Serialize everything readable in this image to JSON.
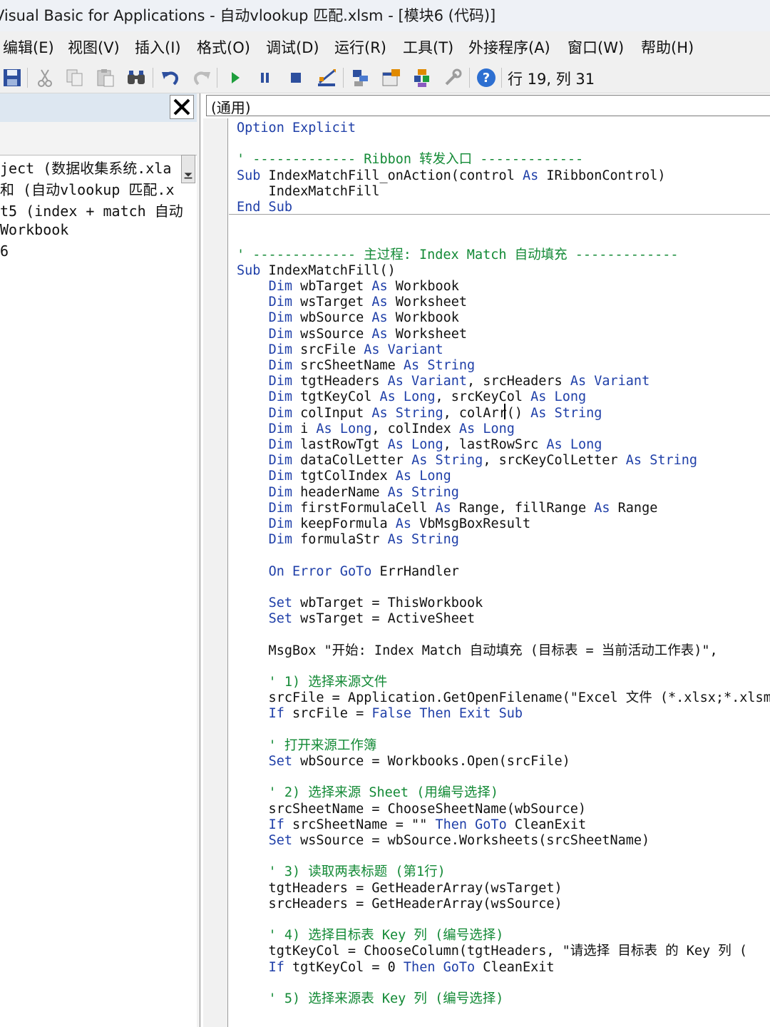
{
  "window": {
    "title": "Visual Basic for Applications - 自动vlookup 匹配.xlsm - [模块6 (代码)]"
  },
  "menu": [
    "编辑(E)",
    "视图(V)",
    "插入(I)",
    "格式(O)",
    "调试(D)",
    "运行(R)",
    "工具(T)",
    "外接程序(A)",
    "窗口(W)",
    "帮助(H)"
  ],
  "toolbar": {
    "icons": [
      "save-icon",
      "cut-icon",
      "copy-icon",
      "paste-icon",
      "find-icon",
      "undo-icon",
      "redo-icon",
      "run-icon",
      "break-icon",
      "reset-icon",
      "design-mode-icon",
      "project-explorer-icon",
      "properties-icon",
      "object-browser-icon",
      "toolbox-icon",
      "help-icon"
    ],
    "cursor_position": "行 19, 列 31"
  },
  "project_explorer": {
    "items": [
      "ject (数据收集系统.xla",
      "和 (自动vlookup 匹配.x",
      "t5 (index + match 自动",
      "Workbook",
      "6"
    ]
  },
  "code_window": {
    "object_combo": "(通用)",
    "lines": [
      [
        {
          "t": "Option Explicit",
          "c": "kw"
        }
      ],
      [],
      [
        {
          "t": "' ------------- Ribbon 转发入口 -------------",
          "c": "cm"
        }
      ],
      [
        {
          "t": "Sub",
          "c": "kw"
        },
        {
          "t": " IndexMatchFill_onAction(control "
        },
        {
          "t": "As",
          "c": "kw"
        },
        {
          "t": " IRibbonControl)"
        }
      ],
      [
        {
          "t": "    IndexMatchFill"
        }
      ],
      [
        {
          "t": "End Sub",
          "c": "kw"
        }
      ],
      [],
      [],
      [
        {
          "t": "' ------------- 主过程: Index Match 自动填充 -------------",
          "c": "cm"
        }
      ],
      [
        {
          "t": "Sub",
          "c": "kw"
        },
        {
          "t": " IndexMatchFill()"
        }
      ],
      [
        {
          "t": "    "
        },
        {
          "t": "Dim",
          "c": "kw"
        },
        {
          "t": " wbTarget "
        },
        {
          "t": "As",
          "c": "kw"
        },
        {
          "t": " Workbook"
        }
      ],
      [
        {
          "t": "    "
        },
        {
          "t": "Dim",
          "c": "kw"
        },
        {
          "t": " wsTarget "
        },
        {
          "t": "As",
          "c": "kw"
        },
        {
          "t": " Worksheet"
        }
      ],
      [
        {
          "t": "    "
        },
        {
          "t": "Dim",
          "c": "kw"
        },
        {
          "t": " wbSource "
        },
        {
          "t": "As",
          "c": "kw"
        },
        {
          "t": " Workbook"
        }
      ],
      [
        {
          "t": "    "
        },
        {
          "t": "Dim",
          "c": "kw"
        },
        {
          "t": " wsSource "
        },
        {
          "t": "As",
          "c": "kw"
        },
        {
          "t": " Worksheet"
        }
      ],
      [
        {
          "t": "    "
        },
        {
          "t": "Dim",
          "c": "kw"
        },
        {
          "t": " srcFile "
        },
        {
          "t": "As Variant",
          "c": "kw"
        }
      ],
      [
        {
          "t": "    "
        },
        {
          "t": "Dim",
          "c": "kw"
        },
        {
          "t": " srcSheetName "
        },
        {
          "t": "As String",
          "c": "kw"
        }
      ],
      [
        {
          "t": "    "
        },
        {
          "t": "Dim",
          "c": "kw"
        },
        {
          "t": " tgtHeaders "
        },
        {
          "t": "As Variant",
          "c": "kw"
        },
        {
          "t": ", srcHeaders "
        },
        {
          "t": "As Variant",
          "c": "kw"
        }
      ],
      [
        {
          "t": "    "
        },
        {
          "t": "Dim",
          "c": "kw"
        },
        {
          "t": " tgtKeyCol "
        },
        {
          "t": "As Long",
          "c": "kw"
        },
        {
          "t": ", srcKeyCol "
        },
        {
          "t": "As Long",
          "c": "kw"
        }
      ],
      [
        {
          "t": "    "
        },
        {
          "t": "Dim",
          "c": "kw"
        },
        {
          "t": " colInput "
        },
        {
          "t": "As String",
          "c": "kw"
        },
        {
          "t": ", colArr() "
        },
        {
          "t": "As String",
          "c": "kw"
        }
      ],
      [
        {
          "t": "    "
        },
        {
          "t": "Dim",
          "c": "kw"
        },
        {
          "t": " i "
        },
        {
          "t": "As Long",
          "c": "kw"
        },
        {
          "t": ", colIndex "
        },
        {
          "t": "As Long",
          "c": "kw"
        }
      ],
      [
        {
          "t": "    "
        },
        {
          "t": "Dim",
          "c": "kw"
        },
        {
          "t": " lastRowTgt "
        },
        {
          "t": "As Long",
          "c": "kw"
        },
        {
          "t": ", lastRowSrc "
        },
        {
          "t": "As Long",
          "c": "kw"
        }
      ],
      [
        {
          "t": "    "
        },
        {
          "t": "Dim",
          "c": "kw"
        },
        {
          "t": " dataColLetter "
        },
        {
          "t": "As String",
          "c": "kw"
        },
        {
          "t": ", srcKeyColLetter "
        },
        {
          "t": "As String",
          "c": "kw"
        }
      ],
      [
        {
          "t": "    "
        },
        {
          "t": "Dim",
          "c": "kw"
        },
        {
          "t": " tgtColIndex "
        },
        {
          "t": "As Long",
          "c": "kw"
        }
      ],
      [
        {
          "t": "    "
        },
        {
          "t": "Dim",
          "c": "kw"
        },
        {
          "t": " headerName "
        },
        {
          "t": "As String",
          "c": "kw"
        }
      ],
      [
        {
          "t": "    "
        },
        {
          "t": "Dim",
          "c": "kw"
        },
        {
          "t": " firstFormulaCell "
        },
        {
          "t": "As",
          "c": "kw"
        },
        {
          "t": " Range, fillRange "
        },
        {
          "t": "As",
          "c": "kw"
        },
        {
          "t": " Range"
        }
      ],
      [
        {
          "t": "    "
        },
        {
          "t": "Dim",
          "c": "kw"
        },
        {
          "t": " keepFormula "
        },
        {
          "t": "As",
          "c": "kw"
        },
        {
          "t": " VbMsgBoxResult"
        }
      ],
      [
        {
          "t": "    "
        },
        {
          "t": "Dim",
          "c": "kw"
        },
        {
          "t": " formulaStr "
        },
        {
          "t": "As String",
          "c": "kw"
        }
      ],
      [],
      [
        {
          "t": "    "
        },
        {
          "t": "On Error GoTo",
          "c": "kw"
        },
        {
          "t": " ErrHandler"
        }
      ],
      [],
      [
        {
          "t": "    "
        },
        {
          "t": "Set",
          "c": "kw"
        },
        {
          "t": " wbTarget = ThisWorkbook"
        }
      ],
      [
        {
          "t": "    "
        },
        {
          "t": "Set",
          "c": "kw"
        },
        {
          "t": " wsTarget = ActiveSheet"
        }
      ],
      [],
      [
        {
          "t": "    MsgBox \"开始: Index Match 自动填充 (目标表 = 当前活动工作表)\","
        }
      ],
      [],
      [
        {
          "t": "    ' 1) 选择来源文件",
          "c": "cm"
        }
      ],
      [
        {
          "t": "    srcFile = Application.GetOpenFilename(\"Excel 文件 (*.xlsx;*.xlsm"
        }
      ],
      [
        {
          "t": "    "
        },
        {
          "t": "If",
          "c": "kw"
        },
        {
          "t": " srcFile = "
        },
        {
          "t": "False Then Exit Sub",
          "c": "kw"
        }
      ],
      [],
      [
        {
          "t": "    ' 打开来源工作簿",
          "c": "cm"
        }
      ],
      [
        {
          "t": "    "
        },
        {
          "t": "Set",
          "c": "kw"
        },
        {
          "t": " wbSource = Workbooks.Open(srcFile)"
        }
      ],
      [],
      [
        {
          "t": "    ' 2) 选择来源 Sheet (用编号选择)",
          "c": "cm"
        }
      ],
      [
        {
          "t": "    srcSheetName = ChooseSheetName(wbSource)"
        }
      ],
      [
        {
          "t": "    "
        },
        {
          "t": "If",
          "c": "kw"
        },
        {
          "t": " srcSheetName = \"\" "
        },
        {
          "t": "Then GoTo",
          "c": "kw"
        },
        {
          "t": " CleanExit"
        }
      ],
      [
        {
          "t": "    "
        },
        {
          "t": "Set",
          "c": "kw"
        },
        {
          "t": " wsSource = wbSource.Worksheets(srcSheetName)"
        }
      ],
      [],
      [
        {
          "t": "    ' 3) 读取两表标题 (第1行)",
          "c": "cm"
        }
      ],
      [
        {
          "t": "    tgtHeaders = GetHeaderArray(wsTarget)"
        }
      ],
      [
        {
          "t": "    srcHeaders = GetHeaderArray(wsSource)"
        }
      ],
      [],
      [
        {
          "t": "    ' 4) 选择目标表 Key 列 (编号选择)",
          "c": "cm"
        }
      ],
      [
        {
          "t": "    tgtKeyCol = ChooseColumn(tgtHeaders, \"请选择 目标表 的 Key 列 ("
        }
      ],
      [
        {
          "t": "    "
        },
        {
          "t": "If",
          "c": "kw"
        },
        {
          "t": " tgtKeyCol = 0 "
        },
        {
          "t": "Then GoTo",
          "c": "kw"
        },
        {
          "t": " CleanExit"
        }
      ],
      [],
      [
        {
          "t": "    ' 5) 选择来源表 Key 列 (编号选择)",
          "c": "cm"
        }
      ]
    ]
  }
}
